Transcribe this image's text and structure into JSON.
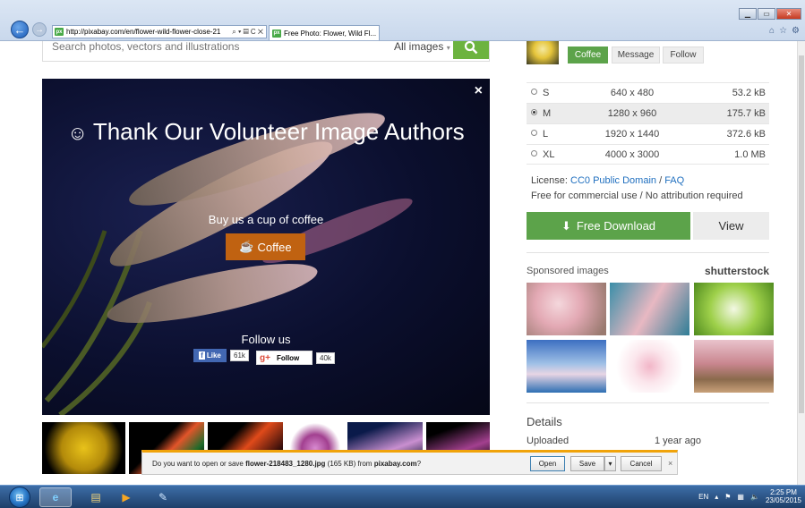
{
  "browser": {
    "address": "http://pixabay.com/en/flower-wild-flower-close-21",
    "address_controls": "⌕ ▾ ▤ C ✕",
    "tab_title": "Free Photo: Flower, Wild Fl...",
    "favicon_text": "px",
    "tab_close": "×"
  },
  "search": {
    "placeholder": "Search photos, vectors and illustrations",
    "type_label": "All images",
    "type_caret": "▾",
    "button_icon": "search-icon"
  },
  "overlay": {
    "close": "×",
    "title": "Thank Our Volunteer Image Authors",
    "smile": "☺",
    "coffee_prompt": "Buy us a cup of coffee",
    "coffee_button": "Coffee",
    "coffee_icon": "☕",
    "follow_label": "Follow us",
    "fb_like": "Like",
    "fb_icon": "f",
    "fb_count": "61k",
    "gplus_icon": "g+",
    "gplus_follow": "Follow",
    "gplus_count": "40k"
  },
  "author": {
    "coffee": "Coffee",
    "message": "Message",
    "follow": "Follow"
  },
  "sizes": [
    {
      "label": "S",
      "dims": "640 x 480",
      "file": "53.2 kB",
      "selected": false
    },
    {
      "label": "M",
      "dims": "1280 x 960",
      "file": "175.7 kB",
      "selected": true
    },
    {
      "label": "L",
      "dims": "1920 x 1440",
      "file": "372.6 kB",
      "selected": false
    },
    {
      "label": "XL",
      "dims": "4000 x 3000",
      "file": "1.0 MB",
      "selected": false
    }
  ],
  "license": {
    "prefix": "License: ",
    "link1": "CC0 Public Domain",
    "sep": " / ",
    "link2": "FAQ",
    "note": "Free for commercial use / No attribution required"
  },
  "download": {
    "icon": "⬇",
    "label": "Free Download",
    "view": "View"
  },
  "sponsored": {
    "label": "Sponsored images",
    "brand": "shutterstock"
  },
  "details": {
    "title": "Details",
    "uploaded_label": "Uploaded",
    "uploaded_value": "1 year ago"
  },
  "download_bar": {
    "text_prefix": "Do you want to open or save ",
    "filename": "flower-218483_1280.jpg",
    "text_mid": " (165 KB) from ",
    "site": "pixabay.com",
    "text_suffix": "?",
    "open": "Open",
    "save": "Save",
    "save_drop": "▾",
    "cancel": "Cancel",
    "close": "×"
  },
  "taskbar": {
    "lang": "EN",
    "time": "2:25 PM",
    "date": "23/05/2015"
  },
  "colors": {
    "accent_green": "#5ca34a",
    "coffee_orange": "#c06211",
    "link_blue": "#1f6fbf"
  }
}
